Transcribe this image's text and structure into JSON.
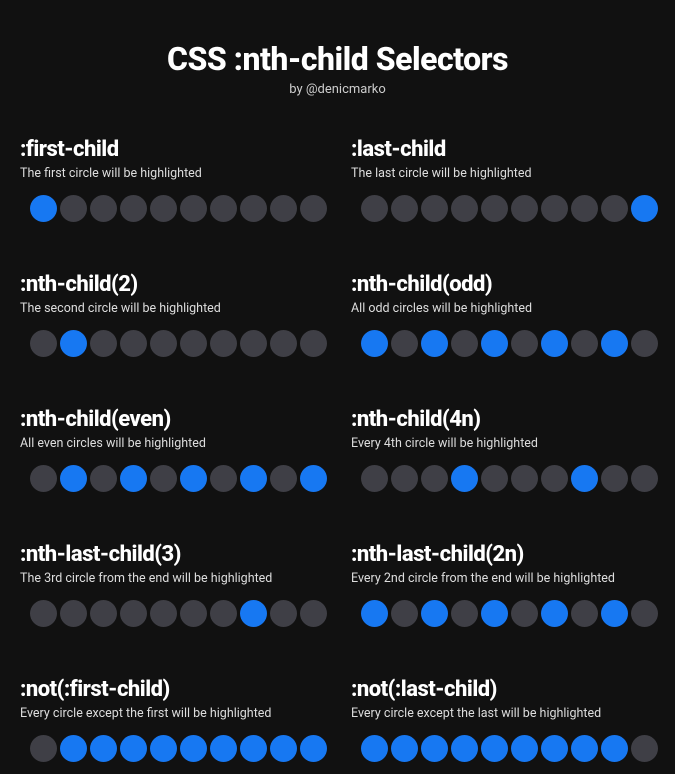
{
  "header": {
    "title": "CSS :nth-child Selectors",
    "subtitle": "by @denicmarko"
  },
  "total_circles": 10,
  "colors": {
    "highlight": "#1778f2",
    "default": "#3f3f46",
    "background": "#111111"
  },
  "examples": [
    {
      "selector": ":first-child",
      "description": "The first circle will be highlighted",
      "highlighted": [
        1
      ]
    },
    {
      "selector": ":last-child",
      "description": "The last circle will be highlighted",
      "highlighted": [
        10
      ]
    },
    {
      "selector": ":nth-child(2)",
      "description": "The second circle will be highlighted",
      "highlighted": [
        2
      ]
    },
    {
      "selector": ":nth-child(odd)",
      "description": "All odd circles will be highlighted",
      "highlighted": [
        1,
        3,
        5,
        7,
        9
      ]
    },
    {
      "selector": ":nth-child(even)",
      "description": "All even circles will be highlighted",
      "highlighted": [
        2,
        4,
        6,
        8,
        10
      ]
    },
    {
      "selector": ":nth-child(4n)",
      "description": "Every 4th circle will be highlighted",
      "highlighted": [
        4,
        8
      ]
    },
    {
      "selector": ":nth-last-child(3)",
      "description": "The 3rd circle from the end will be highlighted",
      "highlighted": [
        8
      ]
    },
    {
      "selector": ":nth-last-child(2n)",
      "description": "Every 2nd circle from the end will be highlighted",
      "highlighted": [
        1,
        3,
        5,
        7,
        9
      ]
    },
    {
      "selector": ":not(:first-child)",
      "description": "Every circle except the first will be highlighted",
      "highlighted": [
        2,
        3,
        4,
        5,
        6,
        7,
        8,
        9,
        10
      ]
    },
    {
      "selector": ":not(:last-child)",
      "description": "Every circle except the last will be highlighted",
      "highlighted": [
        1,
        2,
        3,
        4,
        5,
        6,
        7,
        8,
        9
      ]
    }
  ]
}
